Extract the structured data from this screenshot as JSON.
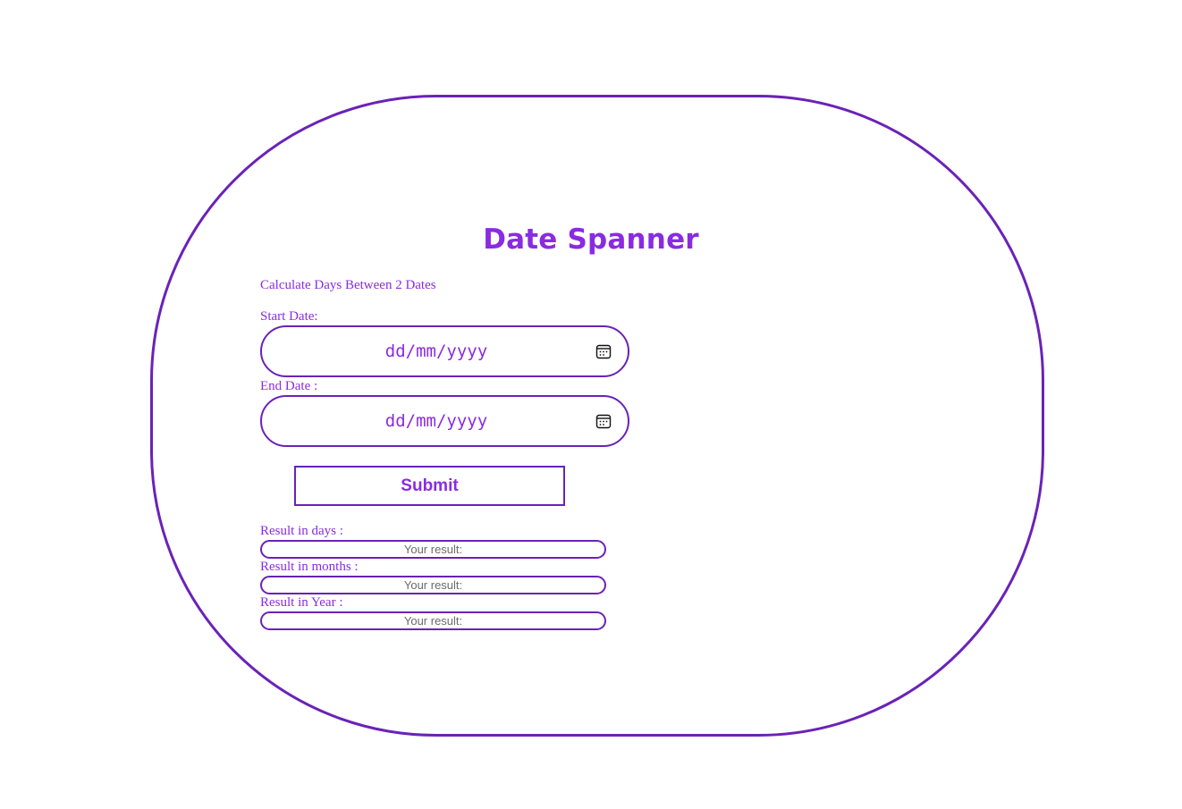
{
  "app": {
    "title": "Date Spanner",
    "subtitle": "Calculate Days Between 2 Dates"
  },
  "start_date": {
    "label": "Start Date:",
    "placeholder": "dd/mm/yyyy",
    "icon": "calendar-icon"
  },
  "end_date": {
    "label": "End Date :",
    "placeholder": "dd/mm/yyyy",
    "icon": "calendar-icon"
  },
  "submit": {
    "label": "Submit"
  },
  "results": {
    "days": {
      "label": "Result in days :",
      "placeholder": "Your result:"
    },
    "months": {
      "label": "Result in months :",
      "placeholder": "Your result:"
    },
    "years": {
      "label": "Result in Year :",
      "placeholder": "Your result:"
    }
  },
  "colors": {
    "accent": "#8a2be2",
    "border": "#6a22b8"
  }
}
